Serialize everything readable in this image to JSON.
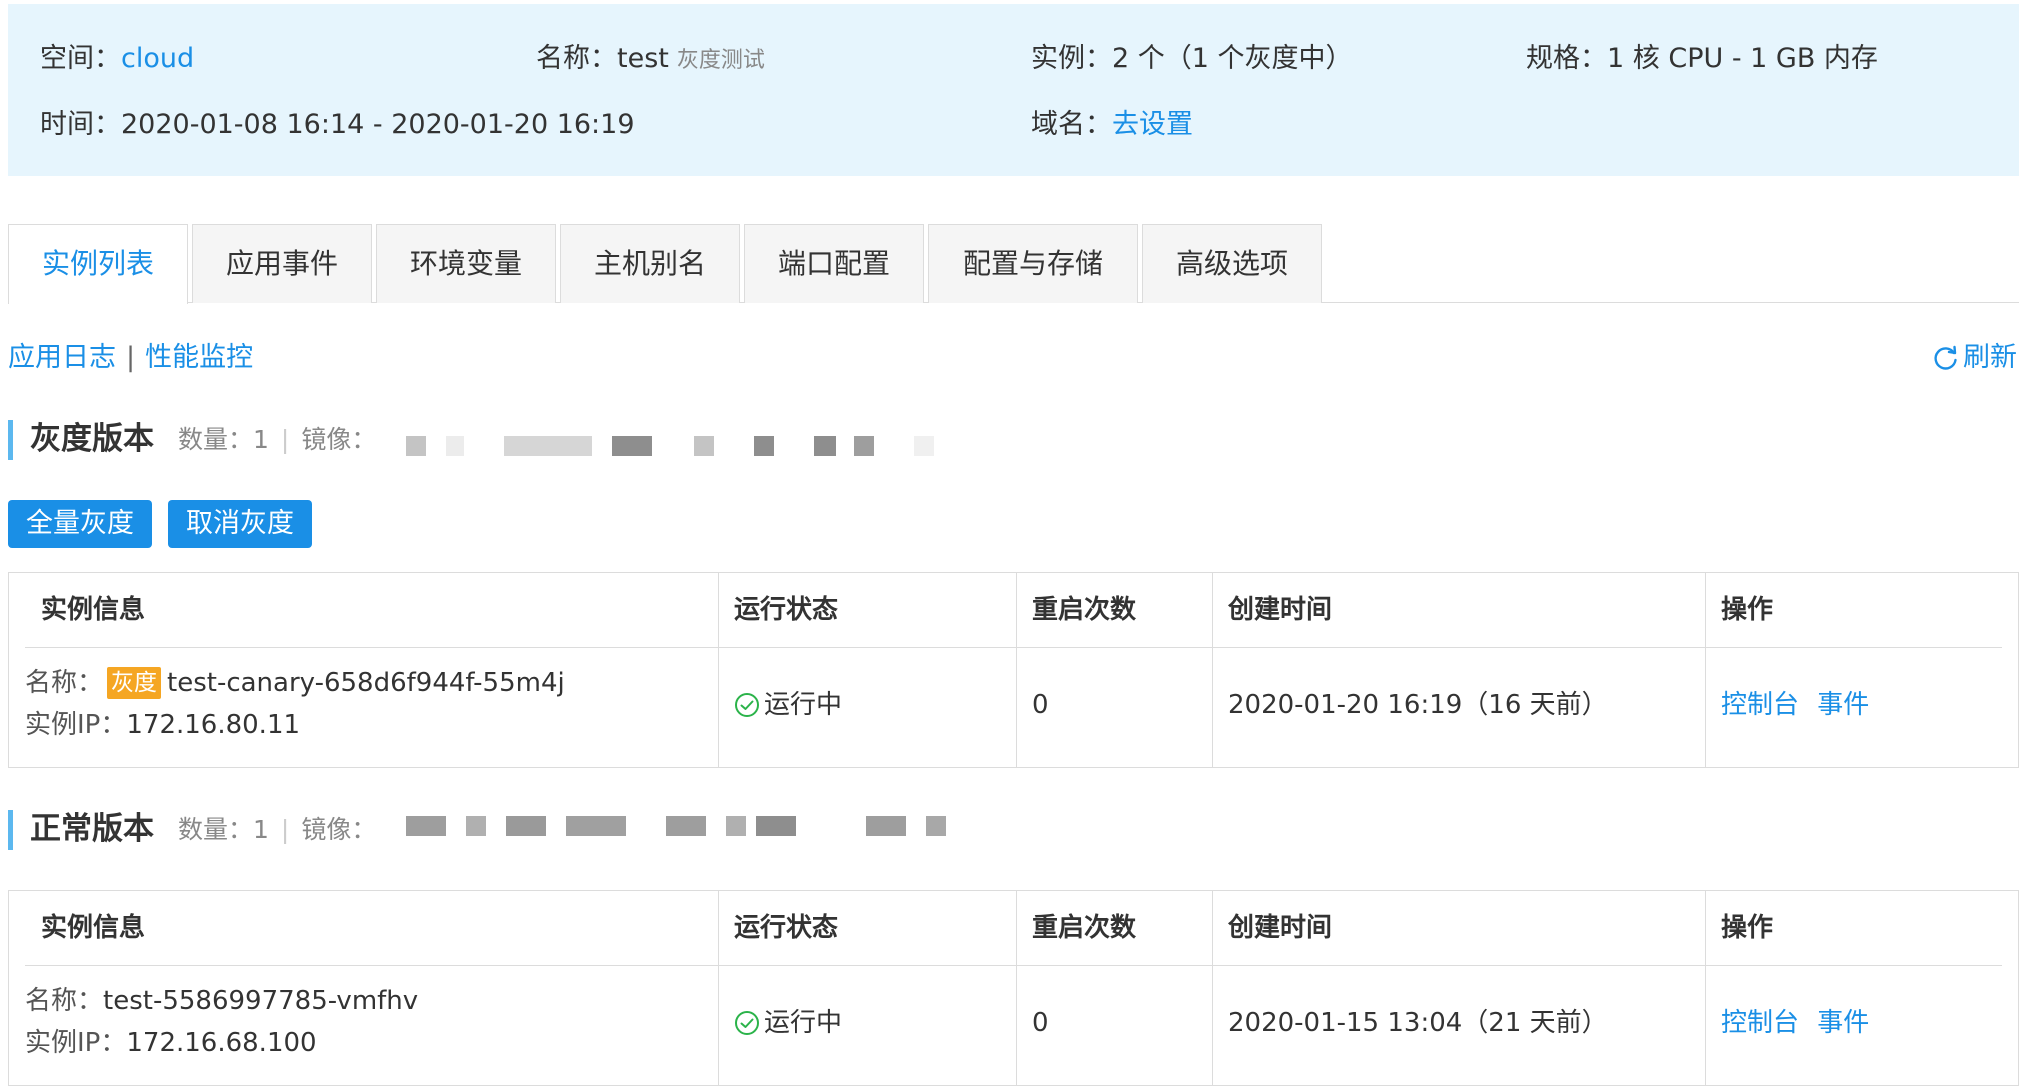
{
  "summary": {
    "space_label": "空间：",
    "space_value": "cloud",
    "name_label": "名称：",
    "name_value": "test",
    "name_sub": "灰度测试",
    "instances_label": "实例：",
    "instances_value": "2 个（1 个灰度中）",
    "spec_label": "规格：",
    "spec_value": "1 核 CPU - 1 GB 内存",
    "time_label": "时间：",
    "time_value": "2020-01-08 16:14 - 2020-01-20 16:19",
    "domain_label": "域名：",
    "domain_value": "去设置"
  },
  "tabs": [
    "实例列表",
    "应用事件",
    "环境变量",
    "主机别名",
    "端口配置",
    "配置与存储",
    "高级选项"
  ],
  "sublinks": {
    "logs": "应用日志",
    "sep": "|",
    "monitor": "性能监控",
    "refresh": "刷新"
  },
  "canary": {
    "title": "灰度版本",
    "count": "数量：1",
    "image_label": "镜像：",
    "buttons": {
      "full": "全量灰度",
      "cancel": "取消灰度"
    }
  },
  "normal": {
    "title": "正常版本",
    "count": "数量：1",
    "image_label": "镜像："
  },
  "table": {
    "headers": [
      "实例信息",
      "运行状态",
      "重启次数",
      "创建时间",
      "操作"
    ]
  },
  "canary_row": {
    "name_label": "名称：",
    "badge": "灰度",
    "name": "test-canary-658d6f944f-55m4j",
    "ip_label": "实例IP：",
    "ip": "172.16.80.11",
    "status": "运行中",
    "restarts": "0",
    "created": "2020-01-20 16:19（16 天前）",
    "action_console": "控制台",
    "action_events": "事件"
  },
  "normal_row": {
    "name_label": "名称：",
    "name": "test-5586997785-vmfhv",
    "ip_label": "实例IP：",
    "ip": "172.16.68.100",
    "status": "运行中",
    "restarts": "0",
    "created": "2020-01-15 13:04（21 天前）",
    "action_console": "控制台",
    "action_events": "事件"
  },
  "colors": {
    "accent": "#1a8fe6",
    "badge": "#f5a623",
    "panel": "#e6f5fd",
    "ok": "#2bb34a"
  }
}
